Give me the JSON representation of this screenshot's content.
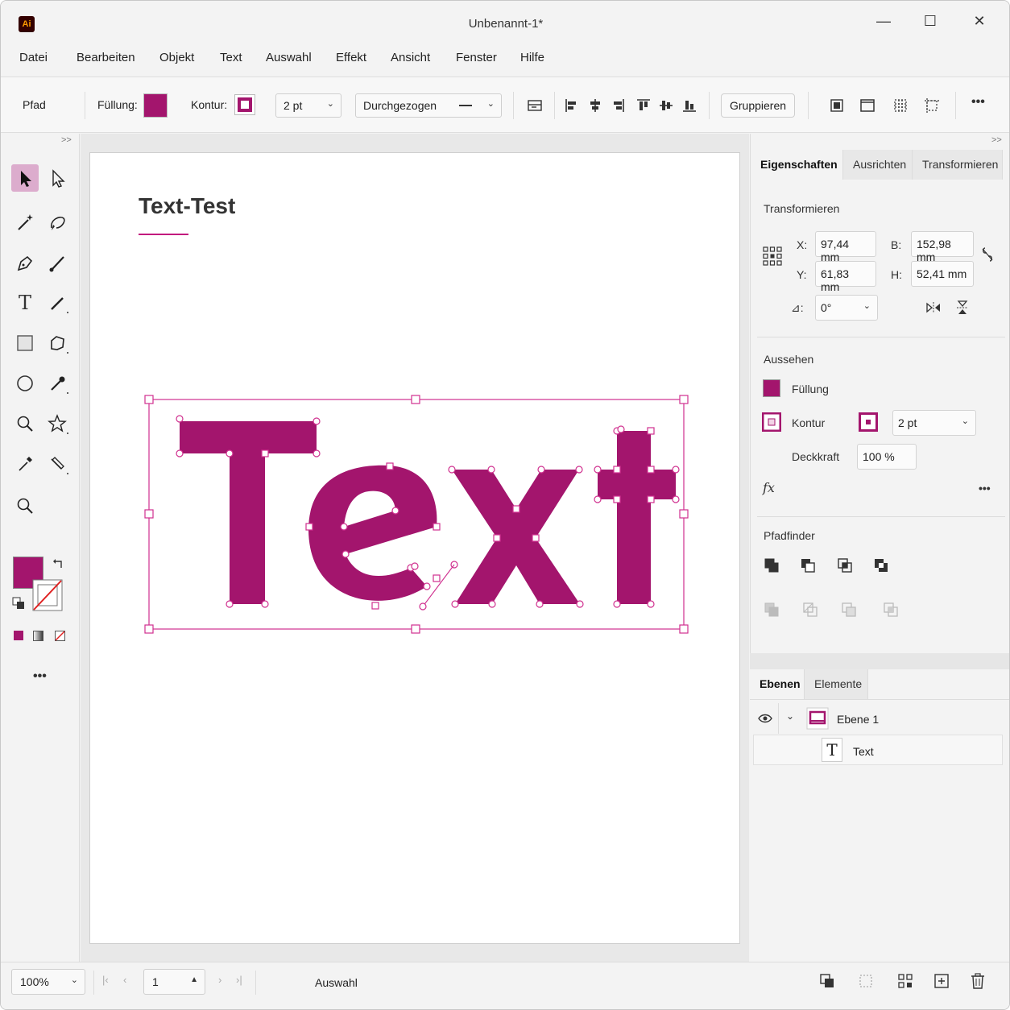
{
  "window": {
    "app_icon": "Ai",
    "title": "Unbenannt-1*",
    "controls": {
      "minimize": "—",
      "maximize": "☐",
      "close": "✕"
    }
  },
  "menu": [
    "Datei",
    "Bearbeiten",
    "Objekt",
    "Text",
    "Auswahl",
    "Effekt",
    "Ansicht",
    "Fenster",
    "Hilfe"
  ],
  "controlbar": {
    "object_type": "Pfad",
    "fill_label": "Füllung:",
    "stroke_label": "Kontur:",
    "stroke_weight": "2 pt",
    "stroke_style": "Durchgezogen",
    "group_button": "Gruppieren",
    "more": "•••"
  },
  "artboard": {
    "title": "Text-Test",
    "text_art": "Text"
  },
  "colors": {
    "accent": "#a3156d",
    "selection": "#d0308f"
  },
  "properties": {
    "tabs": [
      "Eigenschaften",
      "Ausrichten",
      "Transformieren"
    ],
    "transform": {
      "title": "Transformieren",
      "x_label": "X:",
      "x": "97,44 mm",
      "y_label": "Y:",
      "y": "61,83 mm",
      "w_label": "B:",
      "w": "152,98 mm",
      "h_label": "H:",
      "h": "52,41 mm",
      "angle_label": "⊿:",
      "angle": "0°"
    },
    "appearance": {
      "title": "Aussehen",
      "fill": "Füllung",
      "stroke": "Kontur",
      "stroke_weight": "2 pt",
      "opacity_label": "Deckkraft",
      "opacity": "100 %",
      "fx": "fx",
      "more": "•••"
    },
    "pathfinder": {
      "title": "Pfadfinder"
    }
  },
  "layers": {
    "tabs": [
      "Ebenen",
      "Elemente"
    ],
    "layer_name": "Ebene 1",
    "item_name": "Text",
    "item_icon": "T"
  },
  "status": {
    "zoom": "100%",
    "page": "1",
    "mode": "Auswahl"
  }
}
